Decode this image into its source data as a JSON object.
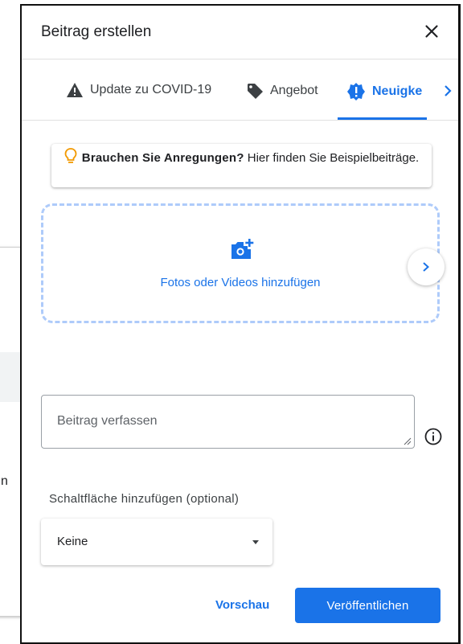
{
  "background": {
    "text_fragment": "n"
  },
  "dialog": {
    "title": "Beitrag erstellen",
    "close_label": "×"
  },
  "tabs": [
    {
      "label": "Update zu COVID-19",
      "icon": "warning-icon",
      "active": false
    },
    {
      "label": "Angebot",
      "icon": "tag-icon",
      "active": false
    },
    {
      "label": "Neuigke",
      "icon": "news-icon",
      "active": true
    }
  ],
  "tip": {
    "bold": "Brauchen Sie Anregungen?",
    "text": " Hier finden Sie Beispielbeiträge."
  },
  "media": {
    "label": "Fotos oder Videos hinzufügen",
    "icon": "add-photo-icon"
  },
  "compose": {
    "placeholder": "Beitrag verfassen"
  },
  "button_section": {
    "label": "Schaltfläche hinzufügen (optional)",
    "selected": "Keine"
  },
  "footer": {
    "preview": "Vorschau",
    "publish": "Veröffentlichen"
  },
  "colors": {
    "accent": "#1a73e8",
    "tip_bulb": "#f29900",
    "dashed_border": "#aecbfa"
  }
}
